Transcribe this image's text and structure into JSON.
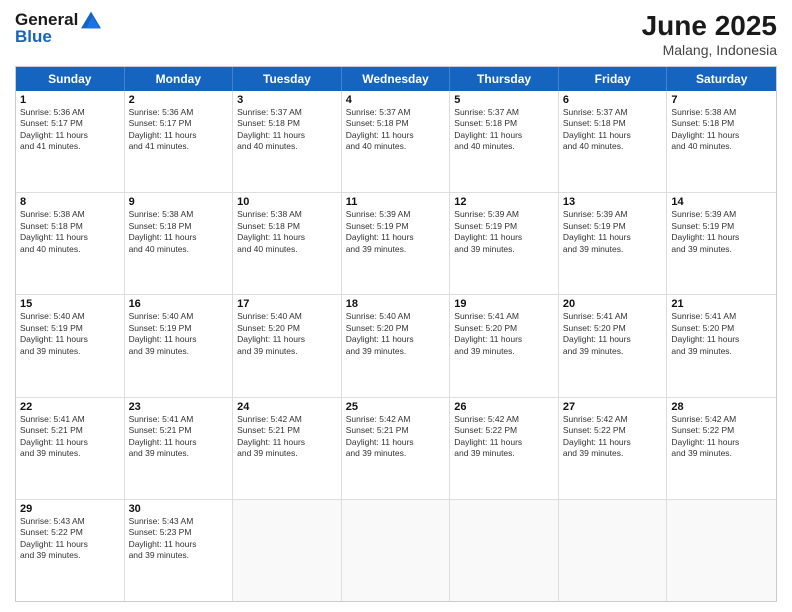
{
  "logo": {
    "line1": "General",
    "line2": "Blue"
  },
  "header": {
    "month": "June 2025",
    "location": "Malang, Indonesia"
  },
  "weekdays": [
    "Sunday",
    "Monday",
    "Tuesday",
    "Wednesday",
    "Thursday",
    "Friday",
    "Saturday"
  ],
  "rows": [
    [
      {
        "day": "",
        "text": ""
      },
      {
        "day": "2",
        "text": "Sunrise: 5:36 AM\nSunset: 5:17 PM\nDaylight: 11 hours\nand 41 minutes."
      },
      {
        "day": "3",
        "text": "Sunrise: 5:37 AM\nSunset: 5:18 PM\nDaylight: 11 hours\nand 40 minutes."
      },
      {
        "day": "4",
        "text": "Sunrise: 5:37 AM\nSunset: 5:18 PM\nDaylight: 11 hours\nand 40 minutes."
      },
      {
        "day": "5",
        "text": "Sunrise: 5:37 AM\nSunset: 5:18 PM\nDaylight: 11 hours\nand 40 minutes."
      },
      {
        "day": "6",
        "text": "Sunrise: 5:37 AM\nSunset: 5:18 PM\nDaylight: 11 hours\nand 40 minutes."
      },
      {
        "day": "7",
        "text": "Sunrise: 5:38 AM\nSunset: 5:18 PM\nDaylight: 11 hours\nand 40 minutes."
      }
    ],
    [
      {
        "day": "8",
        "text": "Sunrise: 5:38 AM\nSunset: 5:18 PM\nDaylight: 11 hours\nand 40 minutes."
      },
      {
        "day": "9",
        "text": "Sunrise: 5:38 AM\nSunset: 5:18 PM\nDaylight: 11 hours\nand 40 minutes."
      },
      {
        "day": "10",
        "text": "Sunrise: 5:38 AM\nSunset: 5:18 PM\nDaylight: 11 hours\nand 40 minutes."
      },
      {
        "day": "11",
        "text": "Sunrise: 5:39 AM\nSunset: 5:19 PM\nDaylight: 11 hours\nand 39 minutes."
      },
      {
        "day": "12",
        "text": "Sunrise: 5:39 AM\nSunset: 5:19 PM\nDaylight: 11 hours\nand 39 minutes."
      },
      {
        "day": "13",
        "text": "Sunrise: 5:39 AM\nSunset: 5:19 PM\nDaylight: 11 hours\nand 39 minutes."
      },
      {
        "day": "14",
        "text": "Sunrise: 5:39 AM\nSunset: 5:19 PM\nDaylight: 11 hours\nand 39 minutes."
      }
    ],
    [
      {
        "day": "15",
        "text": "Sunrise: 5:40 AM\nSunset: 5:19 PM\nDaylight: 11 hours\nand 39 minutes."
      },
      {
        "day": "16",
        "text": "Sunrise: 5:40 AM\nSunset: 5:19 PM\nDaylight: 11 hours\nand 39 minutes."
      },
      {
        "day": "17",
        "text": "Sunrise: 5:40 AM\nSunset: 5:20 PM\nDaylight: 11 hours\nand 39 minutes."
      },
      {
        "day": "18",
        "text": "Sunrise: 5:40 AM\nSunset: 5:20 PM\nDaylight: 11 hours\nand 39 minutes."
      },
      {
        "day": "19",
        "text": "Sunrise: 5:41 AM\nSunset: 5:20 PM\nDaylight: 11 hours\nand 39 minutes."
      },
      {
        "day": "20",
        "text": "Sunrise: 5:41 AM\nSunset: 5:20 PM\nDaylight: 11 hours\nand 39 minutes."
      },
      {
        "day": "21",
        "text": "Sunrise: 5:41 AM\nSunset: 5:20 PM\nDaylight: 11 hours\nand 39 minutes."
      }
    ],
    [
      {
        "day": "22",
        "text": "Sunrise: 5:41 AM\nSunset: 5:21 PM\nDaylight: 11 hours\nand 39 minutes."
      },
      {
        "day": "23",
        "text": "Sunrise: 5:41 AM\nSunset: 5:21 PM\nDaylight: 11 hours\nand 39 minutes."
      },
      {
        "day": "24",
        "text": "Sunrise: 5:42 AM\nSunset: 5:21 PM\nDaylight: 11 hours\nand 39 minutes."
      },
      {
        "day": "25",
        "text": "Sunrise: 5:42 AM\nSunset: 5:21 PM\nDaylight: 11 hours\nand 39 minutes."
      },
      {
        "day": "26",
        "text": "Sunrise: 5:42 AM\nSunset: 5:22 PM\nDaylight: 11 hours\nand 39 minutes."
      },
      {
        "day": "27",
        "text": "Sunrise: 5:42 AM\nSunset: 5:22 PM\nDaylight: 11 hours\nand 39 minutes."
      },
      {
        "day": "28",
        "text": "Sunrise: 5:42 AM\nSunset: 5:22 PM\nDaylight: 11 hours\nand 39 minutes."
      }
    ],
    [
      {
        "day": "29",
        "text": "Sunrise: 5:43 AM\nSunset: 5:22 PM\nDaylight: 11 hours\nand 39 minutes."
      },
      {
        "day": "30",
        "text": "Sunrise: 5:43 AM\nSunset: 5:23 PM\nDaylight: 11 hours\nand 39 minutes."
      },
      {
        "day": "",
        "text": ""
      },
      {
        "day": "",
        "text": ""
      },
      {
        "day": "",
        "text": ""
      },
      {
        "day": "",
        "text": ""
      },
      {
        "day": "",
        "text": ""
      }
    ]
  ],
  "row0_day1": {
    "day": "1",
    "text": "Sunrise: 5:36 AM\nSunset: 5:17 PM\nDaylight: 11 hours\nand 41 minutes."
  }
}
